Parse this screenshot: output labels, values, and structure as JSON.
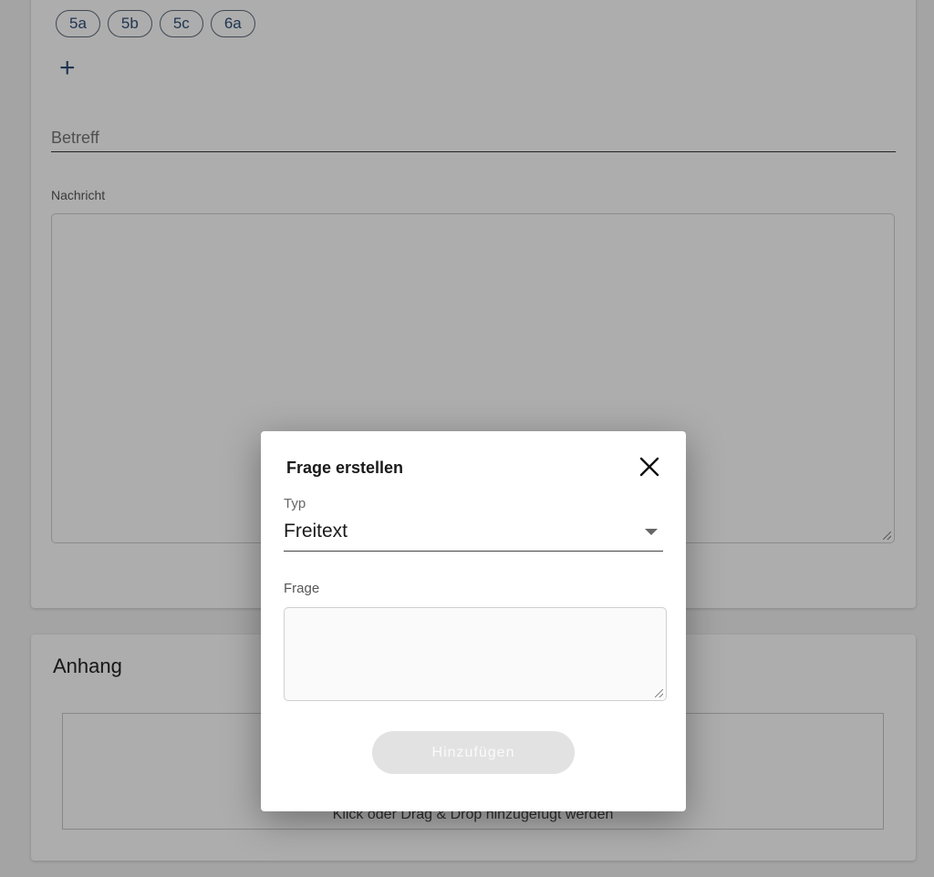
{
  "recipients": {
    "chips": [
      "5a",
      "5b",
      "5c",
      "6a"
    ],
    "add_symbol": "+"
  },
  "form": {
    "subject_placeholder": "Betreff",
    "message_label": "Nachricht",
    "message_value": ""
  },
  "attachment": {
    "title": "Anhang",
    "dropzone_text": "Klick oder Drag & Drop hinzugefügt werden"
  },
  "dialog": {
    "title": "Frage erstellen",
    "close_symbol": "×",
    "type_label": "Typ",
    "type_value": "Freitext",
    "question_label": "Frage",
    "question_value": "",
    "add_button_label": "Hinzufügen"
  },
  "colors": {
    "chip_text": "#2f4f78",
    "button_disabled": "#e2e2e2"
  }
}
